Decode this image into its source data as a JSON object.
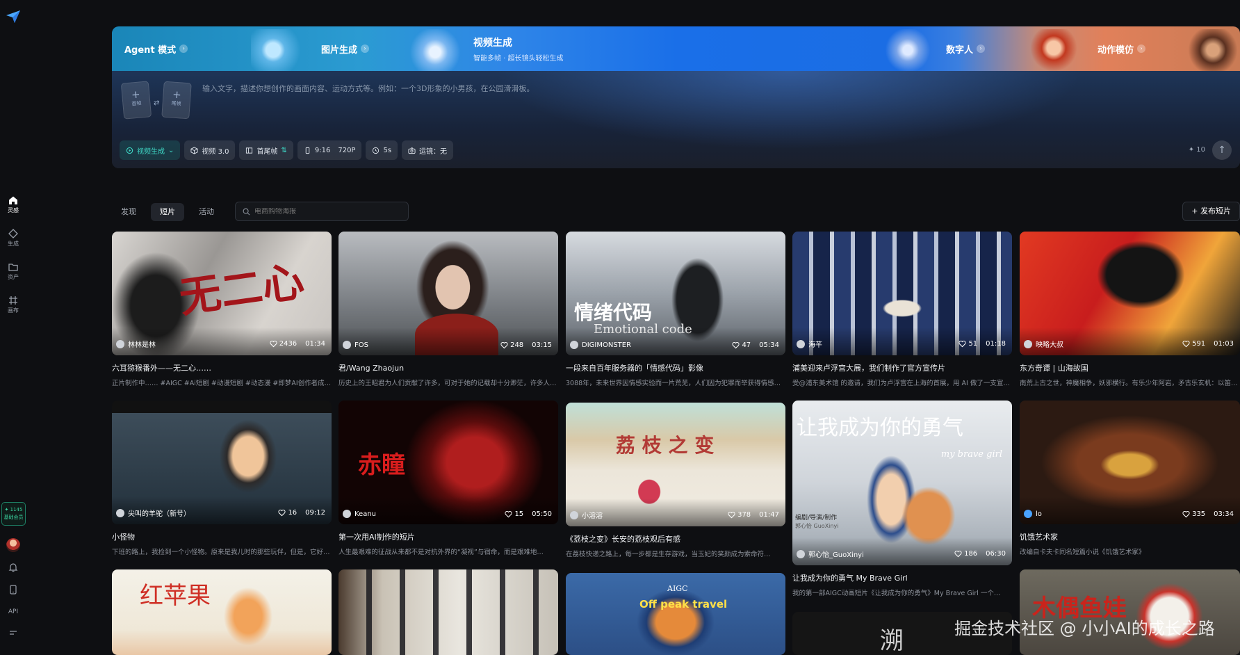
{
  "sidebar": {
    "nav": [
      {
        "label": "灵感",
        "icon": "home-icon"
      },
      {
        "label": "生成",
        "icon": "diamond-icon"
      },
      {
        "label": "资产",
        "icon": "folder-icon"
      },
      {
        "label": "画布",
        "icon": "canvas-icon"
      }
    ],
    "vip_points": "✦ 1145",
    "vip_label": "基础会员",
    "api_label": "API"
  },
  "hero": {
    "tabs": [
      {
        "label": "Agent 模式",
        "sub": ""
      },
      {
        "label": "图片生成",
        "sub": ""
      },
      {
        "label": "视频生成",
        "sub": "智能多帧 · 超长镜头轻松生成"
      },
      {
        "label": "数字人",
        "sub": ""
      },
      {
        "label": "动作模仿",
        "sub": ""
      }
    ],
    "upload_first_label": "首帧",
    "upload_last_label": "尾帧",
    "prompt_placeholder": "输入文字，描述你想创作的画面内容、运动方式等。例如：一个3D形象的小男孩，在公园滑滑板。",
    "toolbar": {
      "mode": "视频生成",
      "model": "视频 3.0",
      "frames": "首尾帧",
      "ratio": "9:16",
      "resolution": "720P",
      "duration": "5s",
      "camera": "运镜：无"
    },
    "credits": "✦ 10",
    "send_symbol": "↑"
  },
  "feed": {
    "tabs": [
      "发现",
      "短片",
      "活动"
    ],
    "active_tab": "短片",
    "search_placeholder": "电商购物海报",
    "publish_label": "+ 发布短片",
    "cards": [
      {
        "author": "林林是林",
        "likes": "2436",
        "duration": "01:34",
        "title": "六耳猕猴番外——无二心……",
        "desc": "正片制作中…… #AIGC #Ai短剧 #动漫短剧 #动态漫 #即梦AI创作者成长计划",
        "overlay": "无二心"
      },
      {
        "author": "FOS",
        "likes": "248",
        "duration": "03:15",
        "title": "君/Wang Zhaojun",
        "desc": "历史上的王昭君为人们贡献了许多，可对于她的记载却十分渺茫，许多人的记忆"
      },
      {
        "author": "DIGIMONSTER",
        "likes": "47",
        "duration": "05:34",
        "title": "一段来自百年服务器的「情感代码」影像",
        "desc": "3088年，未来世界因情感实验而一片荒芜，人们因为犯罪而举获得情感…",
        "overlay": "情绪代码",
        "overlay2": "Emotional code"
      },
      {
        "author": "海芊",
        "likes": "51",
        "duration": "01:18",
        "title": "浦美迎来卢浮宫大展，我们制作了官方宣传片",
        "desc": "受@浦东美术馆 的邀请，我们为卢浮宫在上海的首展，用 AI 做了一支宣传片"
      },
      {
        "author": "映略大叔",
        "likes": "591",
        "duration": "01:03",
        "title": "东方奇谭 | 山海故国",
        "desc": "南荒上古之世，神魔相争，妖邪横行。有乐少年阿岩，矛古乐玄机：以笛声…"
      },
      {
        "author": "尖叫的羊驼（新号）",
        "likes": "16",
        "duration": "09:12",
        "title": "小怪物",
        "desc": "下班的路上，我捡到一个小怪物。原来是我儿时的那些玩伴，但是，它好像…"
      },
      {
        "author": "Keanu",
        "likes": "15",
        "duration": "05:50",
        "title": "第一次用AI制作的短片",
        "desc": "人生最艰难的征战从来都不是对抗外界的“凝视”与宿命，而是艰难地…",
        "overlay": "赤瞳"
      },
      {
        "author": "小溶溶",
        "likes": "378",
        "duration": "01:47",
        "title": "《荔枝之变》长安的荔枝观后有感",
        "desc": "在荔枝快递之路上，每一步都是生存游戏，当玉妃的笑颜成为索命符…",
        "overlay": "荔 枝 之 变"
      },
      {
        "author": "郭心怡_GuoXinyi",
        "likes": "186",
        "duration": "06:30",
        "title": "让我成为你的勇气 My Brave Girl",
        "desc": "我的第一部AIGC动画短片《让我成为你的勇气》My Brave Girl 一个…",
        "overlay": "让我成为你的勇气",
        "overlay2": "my brave girl",
        "credit1": "编剧/导演/制作",
        "credit2": "郭心怡 GuoXinyi"
      },
      {
        "author": "lo",
        "likes": "335",
        "duration": "03:34",
        "title": "饥饿艺术家",
        "desc": "改编自卡夫卡同名短篇小说《饥饿艺术家》"
      },
      {
        "overlay": "红苹果"
      },
      {},
      {
        "overlay": "Off peak travel",
        "overlay_small": "AIGC"
      },
      {
        "overlay": "溯"
      },
      {
        "overlay": "木偶鱼娃"
      }
    ]
  },
  "watermark": "掘金技术社区 @ 小小AI的成长之路",
  "colors": {
    "accent": "#3ed6c4",
    "background": "#0e0f12",
    "vip_green": "#3ad29f"
  }
}
